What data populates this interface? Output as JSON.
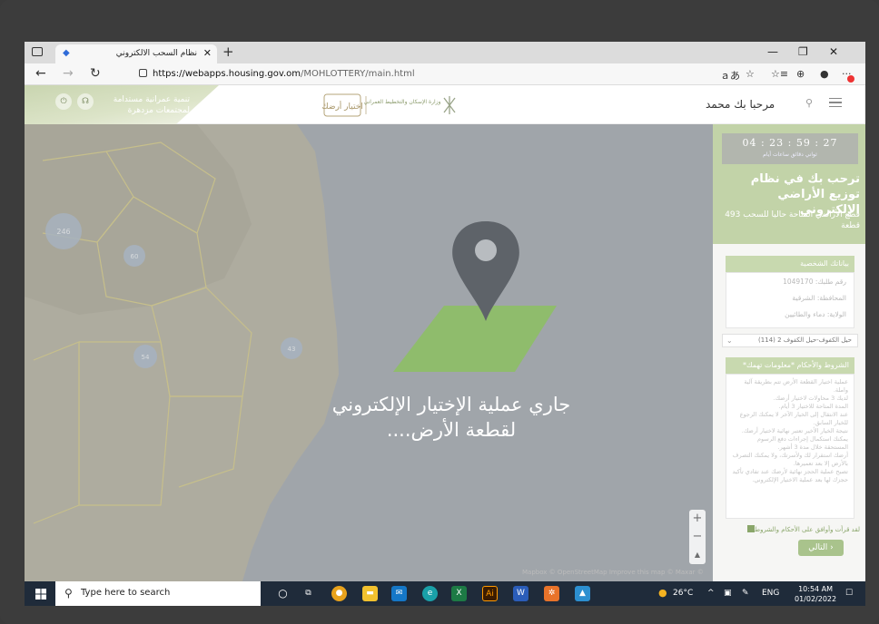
{
  "browser": {
    "tab_title": "نظام السحب الالكتروني",
    "url_host": "https://webapps.housing.gov.om",
    "url_path": "/MOHLOTTERY/main.html"
  },
  "header": {
    "slogan_line1": "تنمية عمرانية مستدامة",
    "slogan_line2": "لمجتمعات مزدهرة",
    "logo_text": "اختيار أرضك",
    "ministry_text": "وزارة الإسكان والتخطيط العمراني",
    "greeting": "مرحبا بك محمد"
  },
  "map": {
    "loading_line1": "جاري عملية الإختيار الإلكتروني",
    "loading_line2": "لقطعة الأرض....",
    "attribution": "Mapbox © OpenStreetMap Improve this map © Maxar ©",
    "zoom_in": "+",
    "zoom_out": "−",
    "compass": "▲",
    "clusters": [
      "246",
      "60",
      "54",
      "43"
    ]
  },
  "panel": {
    "timer": "04 : 23 : 59 : 27",
    "timer_units": "ثواني  دقائق  ساعات  أيام",
    "welcome": "ترحب بك في نظام توزيع الأراضي الإلكتروني",
    "available": "قطع الأراضي المتاحة حاليا للسحب 493 قطعة",
    "personal_header": "بياناتك الشخصية",
    "request_no": "رقم طلبك: 1049170",
    "governorate": "المحافظة: الشرقية",
    "wilayat": "الولاية: دماء والطائيين",
    "selected_area": "حيل الكفوف-حيل الكفوف 2 (114)",
    "terms_header": "الشروط والأحكام *معلومات تهمك*",
    "terms": [
      "عملية اختيار القطعة الأرض تتم بطريقة آلية واملة.",
      "لديك 3 محاولات لاختيار أرضك.",
      "المدة المتاحة للاختيار 3 أيام.",
      "عند الانتقال إلى الخيار الآخر لا يمكنك الرجوع للخيار السابق.",
      "نتيجة الخيار الأخير تعتبر نهائية لاختيار أرضك.",
      "يمكنك استكمال إجراءات دفع الرسوم المستحقة خلال مدة 3 أشهر.",
      "أرضك استقرار لك ولأسرتك، ولا يمكنك التصرف بالأرض إلا بعد تعميرها.",
      "تصبح عملية الحجز نهائية لأرضك عند تفادي تأكيد حجزك لها بعد عملية الاختيار الإلكتروني."
    ],
    "agree_label": "لقد قرأت وأوافق على الأحكام والشروط",
    "next_label": "التالي ›"
  },
  "taskbar": {
    "search_placeholder": "Type here to search",
    "weather": "26°C",
    "lang": "ENG",
    "time": "10:54 AM",
    "date": "01/02/2022"
  },
  "colors": {
    "brand_green": "#8fbc6c",
    "pin_gray": "#5e6369",
    "panel_green": "#c2d3a8"
  }
}
